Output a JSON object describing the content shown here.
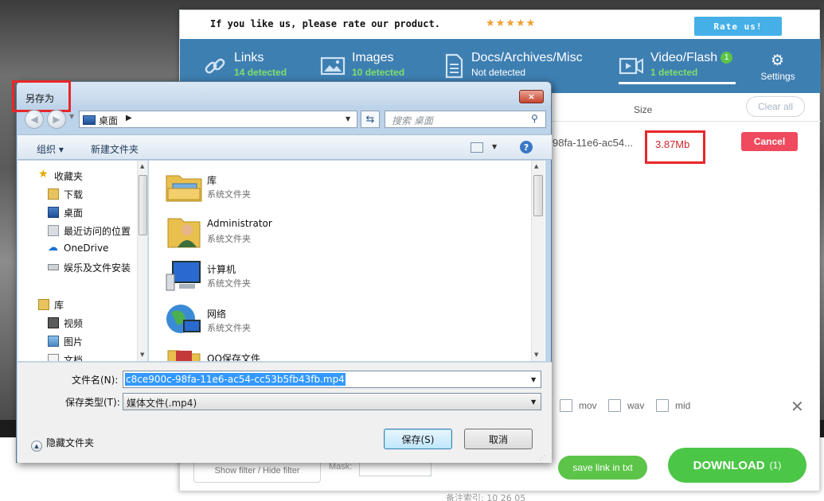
{
  "extension": {
    "rate_text": "If you like us, please rate our product.",
    "stars": "★★★★★",
    "rate_button": "Rate us!",
    "tabs": [
      {
        "title": "Links",
        "count": "14",
        "suffix": " detected",
        "icon": "link-icon"
      },
      {
        "title": "Images",
        "count": "10",
        "suffix": " detected",
        "icon": "image-icon"
      },
      {
        "title": "Docs/Archives/Misc",
        "subtitle": "Not detected",
        "icon": "document-icon"
      },
      {
        "title": "Video/Flash",
        "badge": "1",
        "count": "1",
        "suffix": " detected",
        "icon": "video-icon"
      }
    ],
    "settings_label": "Settings",
    "size_header": "Size",
    "clear_all": "Clear all",
    "file_row": {
      "name": "98fa-11e6-ac54...",
      "size": "3.87Mb",
      "cancel": "Cancel"
    },
    "filters": [
      "mov",
      "wav",
      "mid"
    ],
    "show_filter": "Show filter / Hide filter",
    "mask_label": "Mask:",
    "save_link": "save link in txt",
    "download": "DOWNLOAD",
    "download_count": "(1)",
    "colors": {
      "tab_bar": "#3e7fb2",
      "accent_green": "#4cc647",
      "cancel_red": "#ef4a5e",
      "highlight_red": "#e8272a"
    }
  },
  "dialog": {
    "title": "另存为",
    "close_icon": "×",
    "address": "桌面",
    "search_placeholder": "搜索 桌面",
    "toolbar": {
      "organize": "组织 ▾",
      "new_folder": "新建文件夹",
      "help": "?"
    },
    "nav": {
      "favorites": "收藏夹",
      "items": [
        "下载",
        "桌面",
        "最近访问的位置",
        "OneDrive",
        "娱乐及文件安装"
      ],
      "library": "库",
      "lib_items": [
        "视频",
        "图片",
        "文档"
      ]
    },
    "files": [
      {
        "name": "库",
        "type": "系统文件夹",
        "icon": "library-folder-icon"
      },
      {
        "name": "Administrator",
        "type": "系统文件夹",
        "icon": "user-folder-icon"
      },
      {
        "name": "计算机",
        "type": "系统文件夹",
        "icon": "computer-icon"
      },
      {
        "name": "网络",
        "type": "系统文件夹",
        "icon": "network-icon"
      },
      {
        "name": "QQ保存文件",
        "type": "",
        "icon": "folder-icon"
      }
    ],
    "filename_label": "文件名(N):",
    "filename_value": "c8ce900c-98fa-11e6-ac54-cc53b5fb43fb.mp4",
    "filetype_label": "保存类型(T):",
    "filetype_value": "媒体文件(.mp4)",
    "hide_folders": "隐藏文件夹",
    "save_button": "保存(S)",
    "cancel_button": "取消"
  },
  "background": {
    "footer_text": "备注索引: 10 26 05"
  }
}
